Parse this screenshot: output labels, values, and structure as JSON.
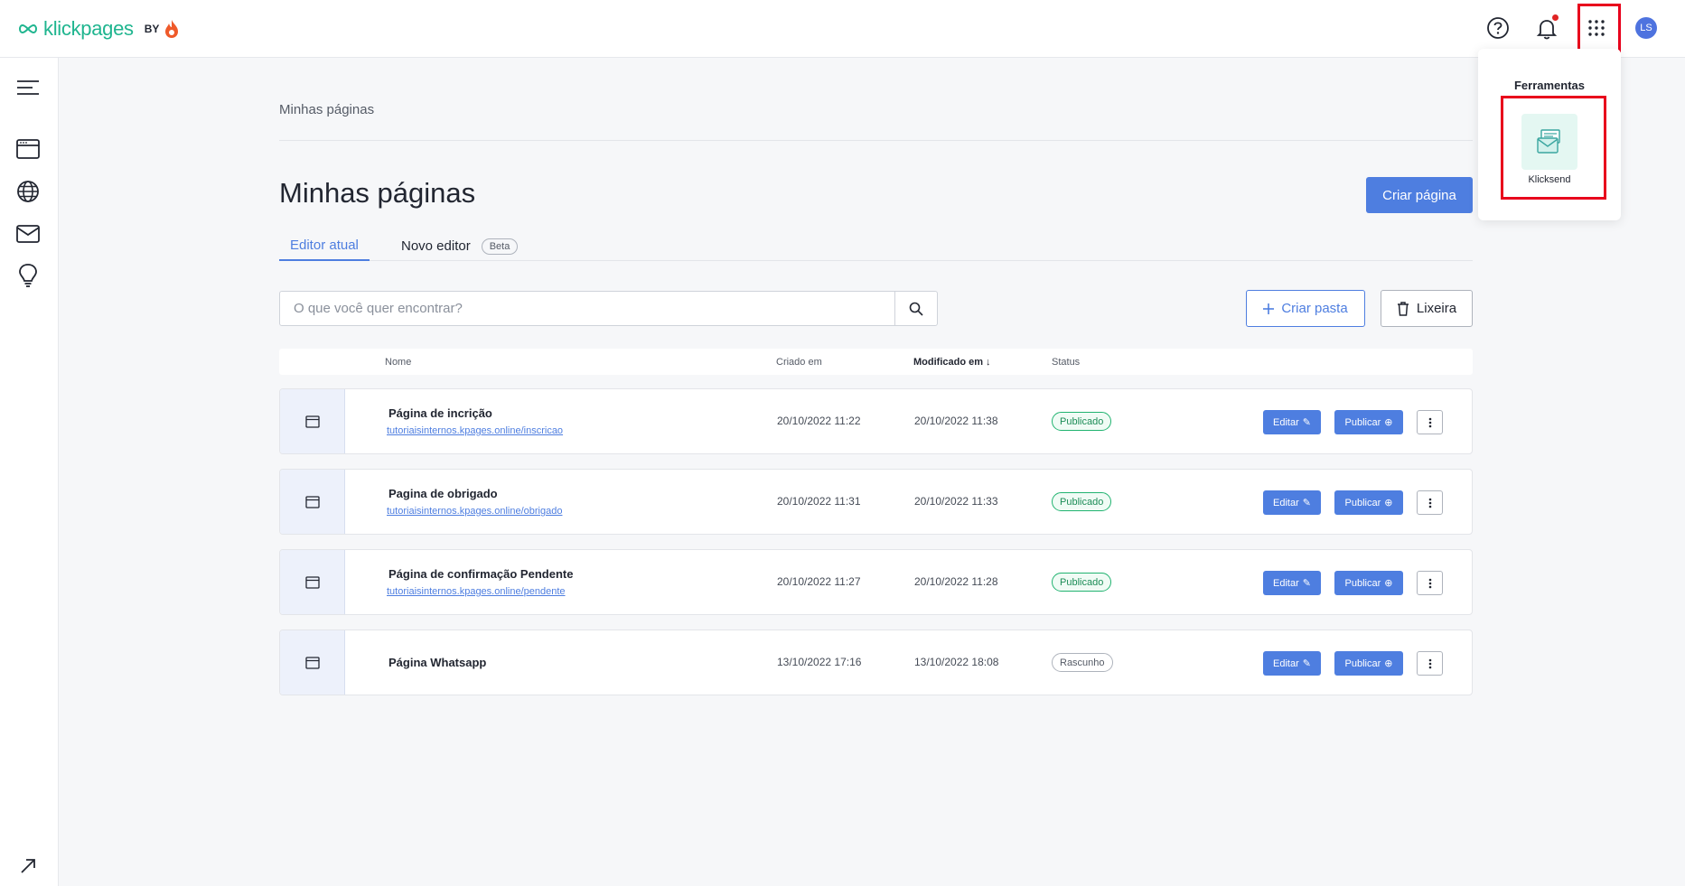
{
  "header": {
    "logo_text": "klickpages",
    "logo_by": "BY",
    "avatar_initials": "LS",
    "icons": [
      "help-icon",
      "bell-icon",
      "apps-grid-icon"
    ]
  },
  "sidebar": {
    "icons": [
      "menu-icon",
      "pages-icon",
      "globe-icon",
      "mail-icon",
      "lightbulb-icon",
      "expand-icon"
    ]
  },
  "breadcrumb": "Minhas páginas",
  "title": "Minhas páginas",
  "create_button": "Criar página",
  "tabs": [
    {
      "label": "Editor atual",
      "active": true
    },
    {
      "label": "Novo editor",
      "badge": "Beta",
      "active": false
    }
  ],
  "search": {
    "placeholder": "O que você quer encontrar?"
  },
  "create_folder_button": "Criar pasta",
  "trash_button": "Lixeira",
  "table": {
    "headers": {
      "name": "Nome",
      "created": "Criado em",
      "modified": "Modificado em ↓",
      "status": "Status"
    },
    "rows": [
      {
        "name": "Página de incrição",
        "url": "tutoriaisinternos.kpages.online/inscricao",
        "created": "20/10/2022 11:22",
        "modified": "20/10/2022 11:38",
        "status": "Publicado"
      },
      {
        "name": "Pagina de obrigado",
        "url": "tutoriaisinternos.kpages.online/obrigado",
        "created": "20/10/2022 11:31",
        "modified": "20/10/2022 11:33",
        "status": "Publicado"
      },
      {
        "name": "Página de confirmação Pendente",
        "url": "tutoriaisinternos.kpages.online/pendente",
        "created": "20/10/2022 11:27",
        "modified": "20/10/2022 11:28",
        "status": "Publicado"
      },
      {
        "name": "Página Whatsapp",
        "url": "",
        "created": "13/10/2022 17:16",
        "modified": "13/10/2022 18:08",
        "status": "Rascunho"
      }
    ],
    "edit_label": "Editar",
    "publish_label": "Publicar"
  },
  "dropdown": {
    "title": "Ferramentas",
    "item_label": "Klicksend"
  },
  "colors": {
    "accent": "#4e7ee0",
    "brand": "#1fb58f",
    "highlight": "#e8001c"
  }
}
